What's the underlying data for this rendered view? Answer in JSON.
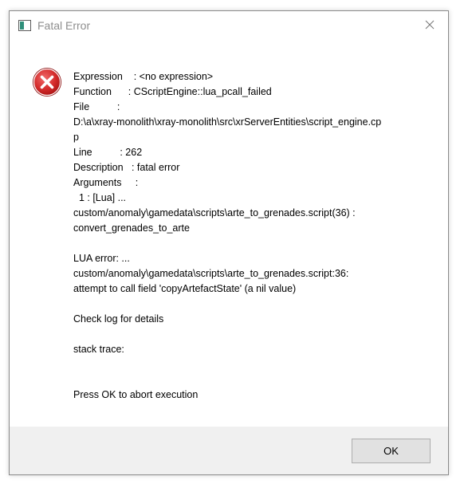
{
  "window": {
    "title": "Fatal Error",
    "close_icon": "close-icon",
    "app_icon": "application-window-icon"
  },
  "dialog": {
    "icon": "error-x-icon",
    "icon_color": "#d42b2b",
    "lines": [
      "Expression    : <no expression>",
      "Function      : CScriptEngine::lua_pcall_failed",
      "File          :",
      "D:\\a\\xray-monolith\\xray-monolith\\src\\xrServerEntities\\script_engine.cp",
      "p",
      "Line          : 262",
      "Description   : fatal error",
      "Arguments     :",
      "  1 : [Lua] ...",
      "custom/anomaly\\gamedata\\scripts\\arte_to_grenades.script(36) :",
      "convert_grenades_to_arte",
      "",
      "LUA error: ...",
      "custom/anomaly\\gamedata\\scripts\\arte_to_grenades.script:36:",
      "attempt to call field 'copyArtefactState' (a nil value)",
      "",
      "Check log for details",
      "",
      "stack trace:",
      "",
      "",
      "Press OK to abort execution"
    ]
  },
  "footer": {
    "ok_label": "OK",
    "background": "#f0f0f0"
  }
}
